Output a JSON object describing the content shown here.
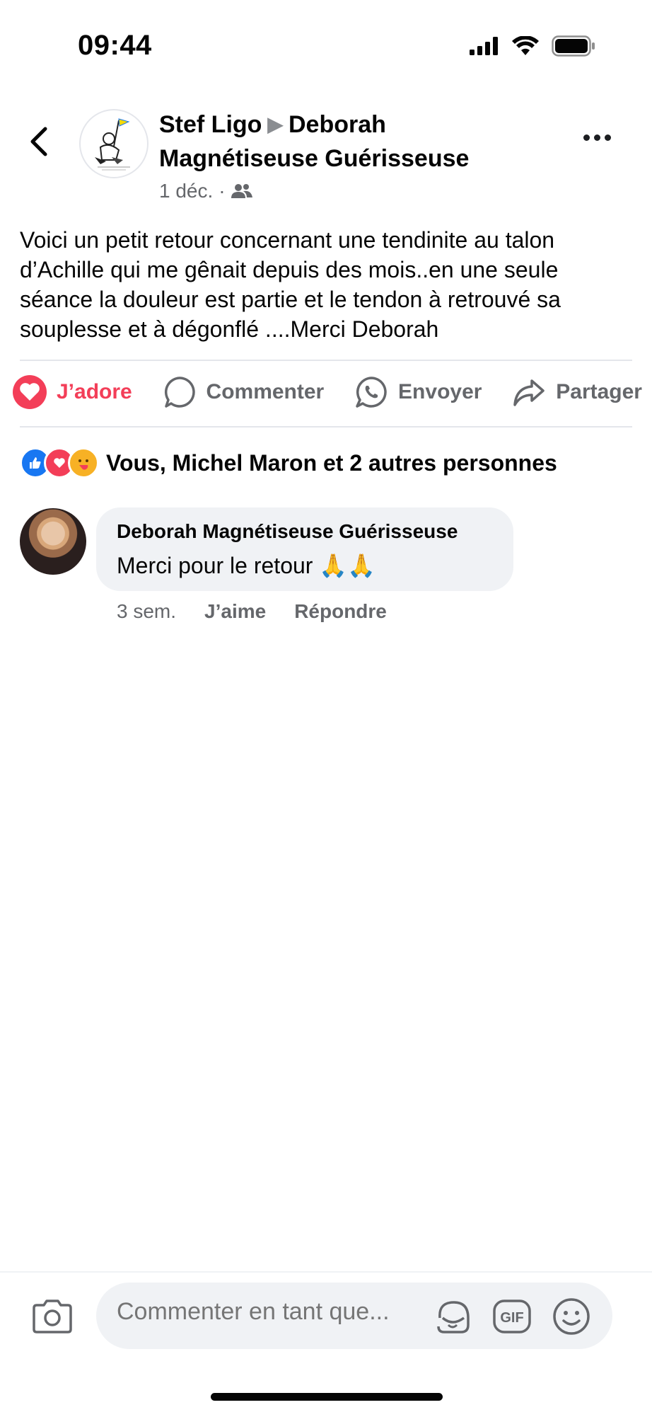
{
  "status": {
    "time": "09:44"
  },
  "header": {
    "author": "Stef Ligo",
    "target": "Deborah Magnétiseuse Guérisseuse",
    "date": "1 déc.",
    "separator": "·"
  },
  "post": {
    "text": "Voici un petit retour concernant une tendinite au talon d’Achille qui me gênait depuis des mois..en une seule séance la douleur est partie et le tendon à retrouvé sa souplesse et à dégonflé ....Merci Deborah"
  },
  "actions": {
    "love": "J’adore",
    "comment": "Commenter",
    "send": "Envoyer",
    "share": "Partager"
  },
  "reactions": {
    "summary": "Vous, Michel Maron et 2 autres personnes",
    "icons": [
      "like-icon",
      "love-icon",
      "care-icon"
    ]
  },
  "comments": [
    {
      "author": "Deborah Magnétiseuse Guérisseuse",
      "text": "Merci pour le retour 🙏🙏",
      "time": "3 sem.",
      "like": "J’aime",
      "reply": "Répondre"
    }
  ],
  "composer": {
    "placeholder": "Commenter en tant que..."
  },
  "colors": {
    "love": "#f33e58",
    "like": "#1877f2",
    "secondary_text": "#65676b",
    "bubble": "#f0f2f5"
  }
}
